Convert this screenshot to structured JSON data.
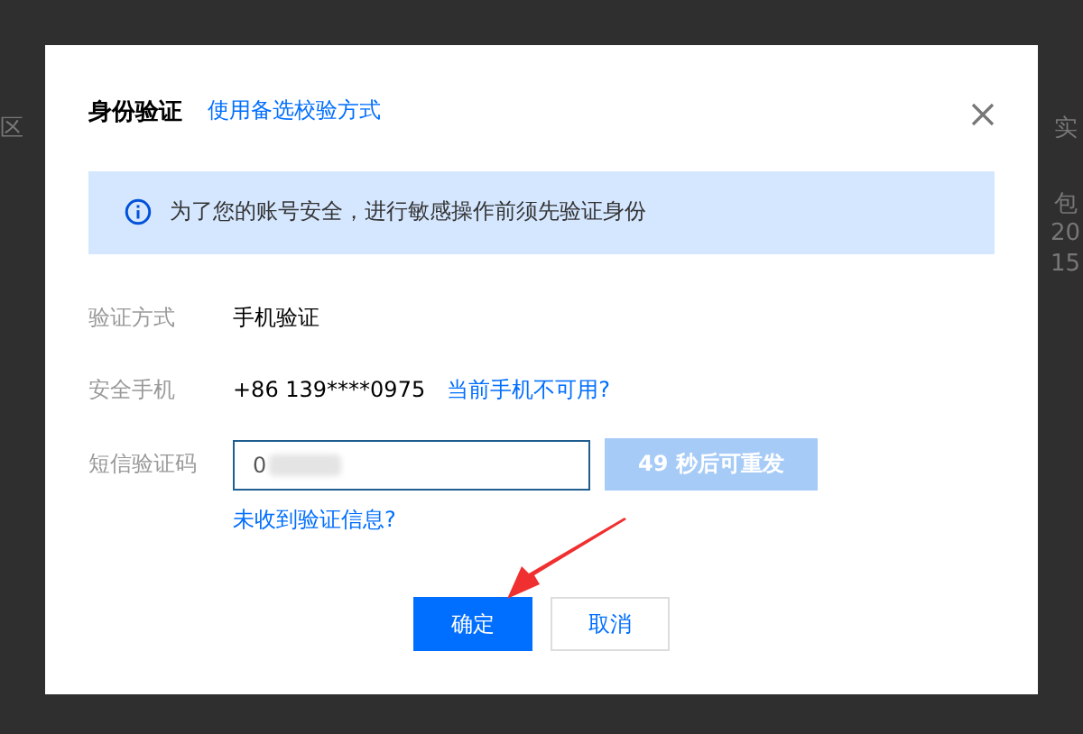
{
  "background": {
    "texts": [
      "区",
      "实",
      "包",
      "20",
      "15"
    ]
  },
  "dialog": {
    "title": "身份验证",
    "alt_link": "使用备选校验方式",
    "alert": {
      "text": "为了您的账号安全，进行敏感操作前须先验证身份"
    },
    "fields": [
      {
        "kind": "text",
        "label": "验证方式",
        "value": "手机验证"
      },
      {
        "kind": "phone",
        "label": "安全手机",
        "value": "+86 139****0975",
        "link": "当前手机不可用?"
      },
      {
        "kind": "code",
        "label": "短信验证码",
        "value": "0",
        "obscured": true,
        "resend": {
          "label": "49 秒后可重发",
          "disabled": true
        }
      }
    ],
    "help_link": "未收到验证信息?",
    "buttons": [
      {
        "label": "确定",
        "kind": "primary"
      },
      {
        "label": "取消",
        "kind": "secondary"
      }
    ],
    "annotation_arrow": true
  }
}
